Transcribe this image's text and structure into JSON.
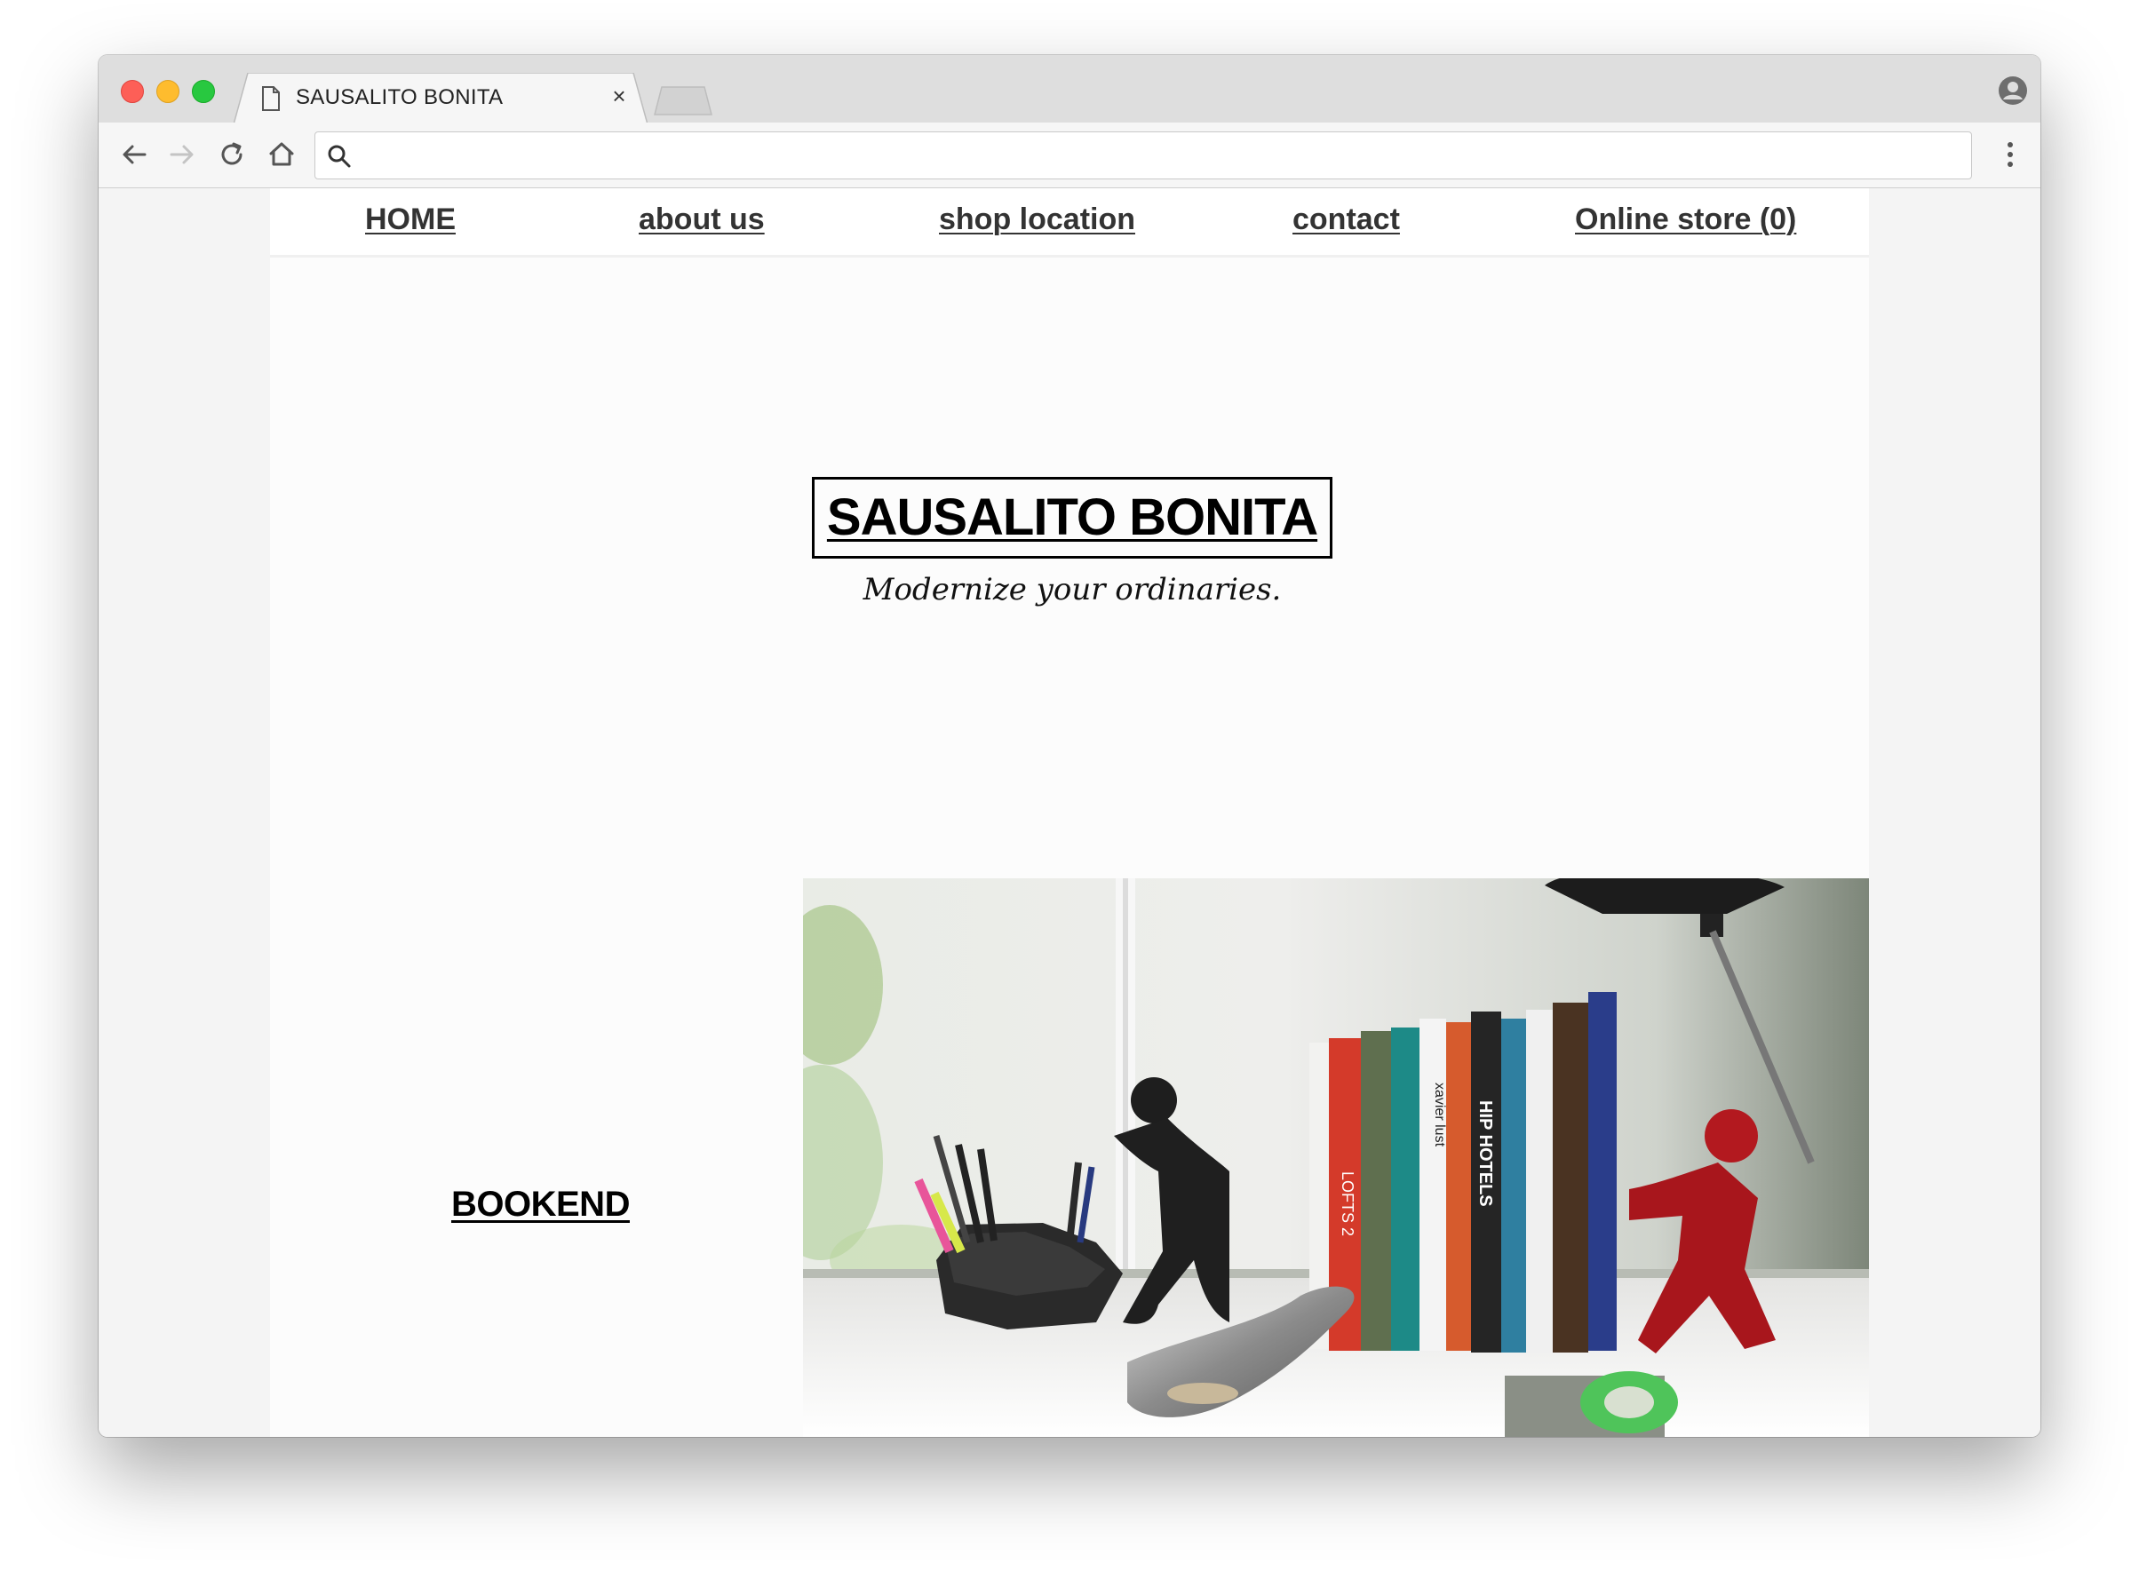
{
  "browser": {
    "tab_title": "SAUSALITO BONITA",
    "address_value": "",
    "icons": {
      "tab": "document-icon",
      "close": "close-icon",
      "back": "back-arrow-icon",
      "forward": "forward-arrow-icon",
      "reload": "reload-icon",
      "home": "home-icon",
      "search": "search-icon",
      "profile": "profile-icon",
      "menu": "more-vertical-icon"
    }
  },
  "nav": {
    "items": [
      {
        "label": "HOME"
      },
      {
        "label": "about us"
      },
      {
        "label": "shop location"
      },
      {
        "label": "contact"
      },
      {
        "label": "Online store (0)"
      }
    ]
  },
  "hero": {
    "title": "SAUSALITO BONITA",
    "tagline": "Modernize your ordinaries."
  },
  "product": {
    "label": "BOOKEND"
  },
  "colors": {
    "nav_text": "#333333",
    "accent_red": "#b3191f",
    "title_text": "#000000"
  }
}
